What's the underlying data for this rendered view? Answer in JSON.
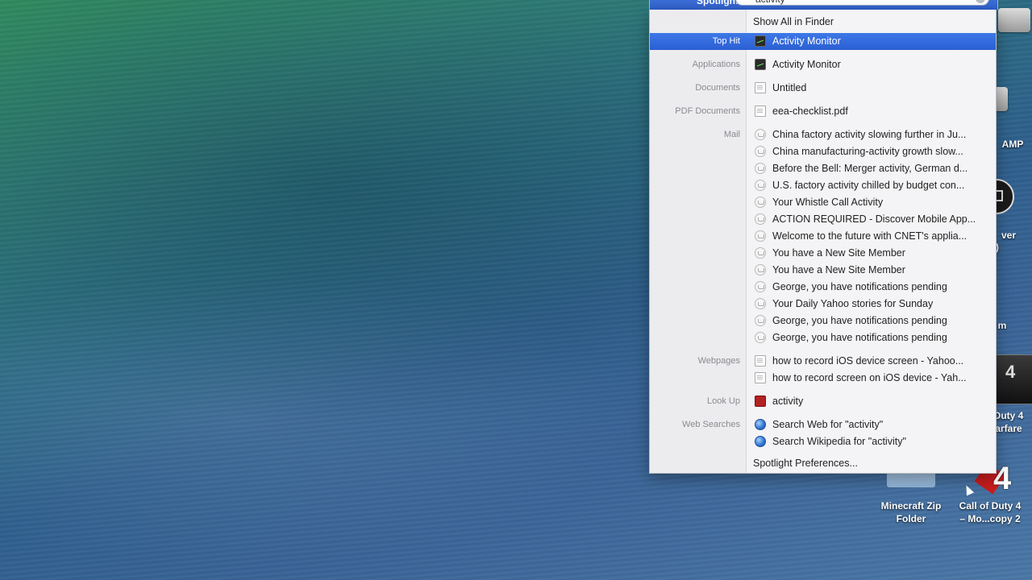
{
  "spotlight": {
    "label": "Spotlight",
    "query": "activity",
    "show_all": "Show All in Finder",
    "preferences": "Spotlight Preferences...",
    "categories": {
      "top_hit": "Top Hit",
      "applications": "Applications",
      "documents": "Documents",
      "pdf_documents": "PDF Documents",
      "mail": "Mail",
      "webpages": "Webpages",
      "look_up": "Look Up",
      "web_searches": "Web Searches"
    },
    "top_hit": "Activity Monitor",
    "applications": [
      "Activity Monitor"
    ],
    "documents": [
      "Untitled"
    ],
    "pdf_documents": [
      "eea-checklist.pdf"
    ],
    "mail": [
      "China factory activity slowing further in Ju...",
      "China manufacturing-activity growth slow...",
      "Before the Bell: Merger activity, German d...",
      "U.S. factory activity chilled by budget con...",
      "Your Whistle Call Activity",
      "ACTION REQUIRED - Discover Mobile App...",
      "Welcome to the future with CNET's applia...",
      "You have a New Site Member",
      "You have a New Site Member",
      "George, you have notifications pending",
      "Your Daily Yahoo stories for Sunday",
      "George, you have notifications pending",
      "George, you have notifications pending"
    ],
    "webpages": [
      "how to record iOS device screen - Yahoo...",
      "how to record screen on iOS device - Yah..."
    ],
    "look_up": [
      "activity"
    ],
    "web_searches": [
      "Search Web for \"activity\"",
      "Search Wikipedia for \"activity\""
    ]
  },
  "desktop": {
    "icons": {
      "amp_label": "AMP",
      "server_label_1": "ver",
      "server_label_2": ")",
      "m_label": "m",
      "cod_mw_label_1": "Duty 4",
      "cod_mw_label_2": "arfare",
      "minecraft_label_1": "Minecraft Zip",
      "minecraft_label_2": "Folder",
      "cod_copy_label_1": "Call of Duty 4",
      "cod_copy_label_2": "– Mo...copy 2"
    }
  },
  "colors": {
    "selection": "#2f66dc",
    "panel": "#f4f4f6"
  }
}
